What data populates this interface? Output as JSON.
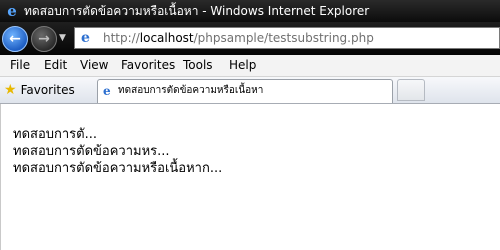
{
  "window": {
    "title": "ทดสอบการตัดข้อความหรือเนื้อหา - Windows Internet Explorer"
  },
  "address": {
    "url_prefix": "http://",
    "url_host": "localhost",
    "url_path": "/phpsample/testsubstring.php"
  },
  "menu": [
    "File",
    "Edit",
    "View",
    "Favorites",
    "Tools",
    "Help"
  ],
  "favorites_label": "Favorites",
  "tab": {
    "title": "ทดสอบการตัดข้อความหรือเนื้อหา"
  },
  "content": {
    "lines": [
      "ทดสอบการตั...",
      "ทดสอบการตัดข้อความหร...",
      "ทดสอบการตัดข้อความหรือเนื้อหาก..."
    ]
  },
  "icons": {
    "window_icon": "ie-logo-icon",
    "back": "back-arrow-icon",
    "forward": "forward-arrow-icon",
    "page": "ie-page-icon",
    "favorites": "star-icon"
  },
  "colors": {
    "titlebar": "#111111",
    "back_button": "#2a6fd6",
    "star": "#e8b800"
  }
}
